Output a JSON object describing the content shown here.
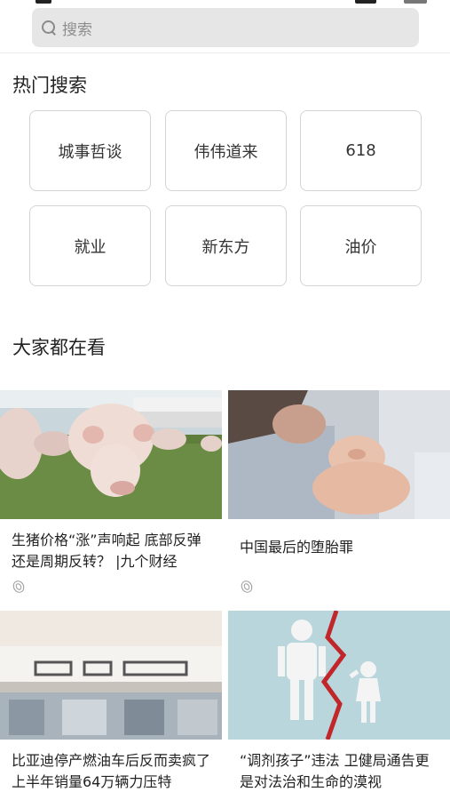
{
  "search": {
    "placeholder": "搜索"
  },
  "hot_search": {
    "title": "热门搜索",
    "items": [
      "城事哲谈",
      "伟伟道来",
      "618",
      "就业",
      "新东方",
      "油价"
    ]
  },
  "trending": {
    "title": "大家都在看",
    "cards": [
      {
        "title": "生猪价格“涨”声响起 底部反弹还是周期反转？ |九个财经",
        "image": "pigs-in-field-photo"
      },
      {
        "title": "中国最后的堕胎罪",
        "image": "mother-holding-newborn-photo"
      },
      {
        "title": "比亚迪停产燃油车后反而卖疯了 上半年销量64万辆力压特",
        "image": "byd-showroom-photo"
      },
      {
        "title": "“调剂孩子”违法 卫健局通告更是对法治和生命的漠视",
        "image": "parent-child-cutout-photo"
      }
    ]
  },
  "colors": {
    "search_bg": "#e6e6e6",
    "border": "#d4d4d4",
    "text": "#222222"
  }
}
